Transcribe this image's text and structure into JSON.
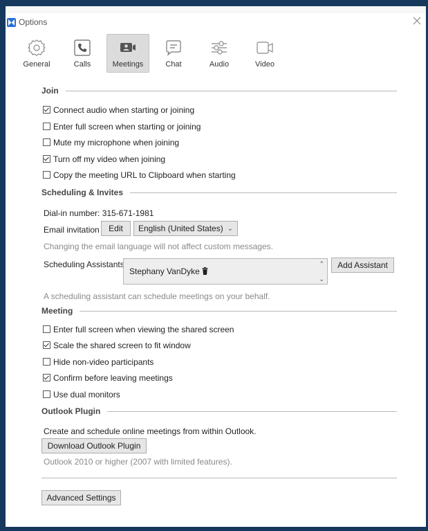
{
  "window": {
    "title": "Options"
  },
  "toolbar": {
    "items": [
      {
        "label": "General",
        "icon": "gear-icon"
      },
      {
        "label": "Calls",
        "icon": "phone-icon"
      },
      {
        "label": "Meetings",
        "icon": "meetings-icon"
      },
      {
        "label": "Chat",
        "icon": "chat-icon"
      },
      {
        "label": "Audio",
        "icon": "sliders-icon"
      },
      {
        "label": "Video",
        "icon": "video-camera-icon"
      }
    ],
    "active": "Meetings"
  },
  "join": {
    "title": "Join",
    "options": [
      {
        "label": "Connect audio when starting or joining",
        "checked": true
      },
      {
        "label": "Enter full screen when starting or joining",
        "checked": false
      },
      {
        "label": "Mute my microphone when joining",
        "checked": false
      },
      {
        "label": "Turn off my video when joining",
        "checked": true
      },
      {
        "label": "Copy the meeting URL to Clipboard when starting",
        "checked": false
      }
    ]
  },
  "scheduling": {
    "title": "Scheduling & Invites",
    "dial_in": "Dial-in number: 315-671-1981",
    "email_label": "Email invitation",
    "edit_label": "Edit",
    "language_value": "English (United States)",
    "language_note": "Changing the email language will not affect custom messages.",
    "assistants_label": "Scheduling Assistants",
    "assistant_name": "Stephany VanDyke",
    "add_assistant_label": "Add Assistant",
    "assistant_note": "A scheduling assistant can schedule meetings on your behalf."
  },
  "meeting": {
    "title": "Meeting",
    "options": [
      {
        "label": "Enter full screen when viewing the shared screen",
        "checked": false
      },
      {
        "label": "Scale the shared screen to fit window",
        "checked": true
      },
      {
        "label": "Hide non-video participants",
        "checked": false
      },
      {
        "label": "Confirm before leaving meetings",
        "checked": true
      },
      {
        "label": "Use dual monitors",
        "checked": false
      }
    ]
  },
  "outlook": {
    "title": "Outlook Plugin",
    "description": "Create and schedule online meetings from within Outlook.",
    "download_label": "Download Outlook Plugin",
    "note": "Outlook 2010 or higher (2007 with limited features)."
  },
  "footer": {
    "advanced_label": "Advanced Settings"
  },
  "colors": {
    "frame": "#16385c",
    "accent": "#2a6fd6",
    "button_bg": "#e6e6e6"
  }
}
